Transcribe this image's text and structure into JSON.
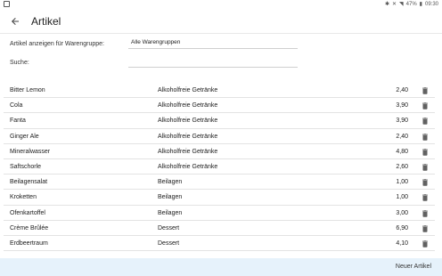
{
  "statusbar": {
    "battery": "47%",
    "time": "09:30"
  },
  "header": {
    "title": "Artikel"
  },
  "filter": {
    "group_label": "Artikel anzeigen für Warengruppe:",
    "group_value": "Alle Warengruppen",
    "search_label": "Suche:",
    "search_value": ""
  },
  "items": [
    {
      "name": "Bitter Lemon",
      "group": "Alkoholfreie Getränke",
      "price": "2,40"
    },
    {
      "name": "Cola",
      "group": "Alkoholfreie Getränke",
      "price": "3,90"
    },
    {
      "name": "Fanta",
      "group": "Alkoholfreie Getränke",
      "price": "3,90"
    },
    {
      "name": "Ginger Ale",
      "group": "Alkoholfreie Getränke",
      "price": "2,40"
    },
    {
      "name": "Mineralwasser",
      "group": "Alkoholfreie Getränke",
      "price": "4,80"
    },
    {
      "name": "Saftschorle",
      "group": "Alkoholfreie Getränke",
      "price": "2,60"
    },
    {
      "name": "Beilagensalat",
      "group": "Beilagen",
      "price": "1,00"
    },
    {
      "name": "Kroketten",
      "group": "Beilagen",
      "price": "1,00"
    },
    {
      "name": "Ofenkartoffel",
      "group": "Beilagen",
      "price": "3,00"
    },
    {
      "name": "Crème Brûlée",
      "group": "Dessert",
      "price": "6,90"
    },
    {
      "name": "Erdbeertraum",
      "group": "Dessert",
      "price": "4,10"
    }
  ],
  "footer": {
    "new_item_label": "Neuer Artikel"
  },
  "icons": {
    "back": "arrow-back-icon",
    "delete": "trash-icon"
  },
  "colors": {
    "footer_bg": "#e6f2fb",
    "icon_gray": "#616161"
  }
}
